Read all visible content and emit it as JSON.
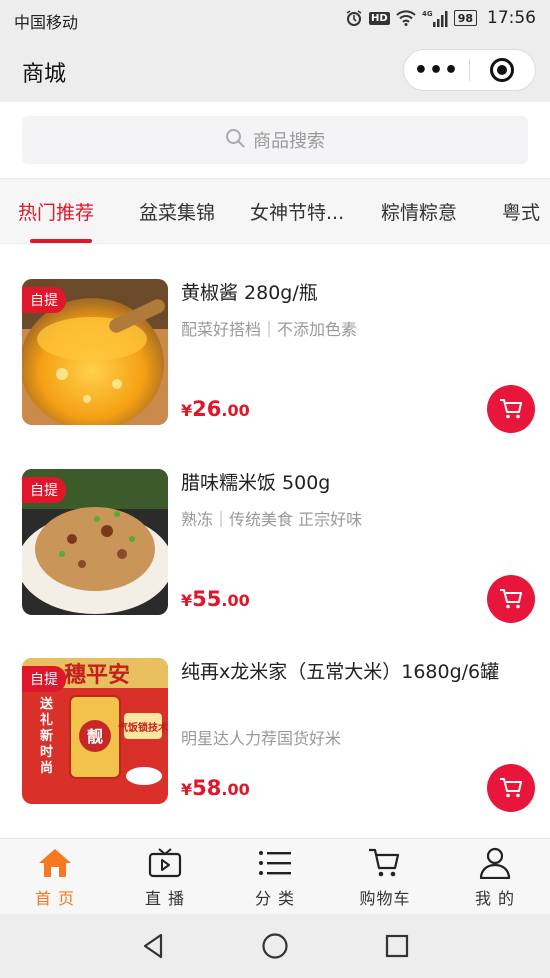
{
  "status_bar": {
    "carrier": "中国移动",
    "hd": "HD",
    "network": "4G",
    "battery": "98",
    "time": "17:56"
  },
  "nav": {
    "title": "商城",
    "more": "•••"
  },
  "search": {
    "placeholder": "商品搜索"
  },
  "tabs": [
    "热门推荐",
    "盆菜集锦",
    "女神节特...",
    "粽情粽意",
    "粤式"
  ],
  "products": [
    {
      "badge": "自提",
      "title": "黄椒酱 280g/瓶",
      "subtitle": "配菜好搭档｜不添加色素",
      "currency": "¥",
      "price_int": "26",
      "price_dec": ".00"
    },
    {
      "badge": "自提",
      "title": "腊味糯米饭 500g",
      "subtitle": "熟冻｜传统美食 正宗好味",
      "currency": "¥",
      "price_int": "55",
      "price_dec": ".00"
    },
    {
      "badge": "自提",
      "title": "纯再x龙米家（五常大米）1680g/6罐",
      "subtitle": "明星达人力荐国货好米",
      "currency": "¥",
      "price_int": "58",
      "price_dec": ".00",
      "image_text": {
        "top": "穗平安",
        "side": "送礼新时尚",
        "seal": "靓",
        "slogan": "气饭锁技术"
      }
    }
  ],
  "bottom_nav": [
    {
      "label": "首 页",
      "icon": "home-icon"
    },
    {
      "label": "直 播",
      "icon": "tv-icon"
    },
    {
      "label": "分 类",
      "icon": "list-icon"
    },
    {
      "label": "购物车",
      "icon": "cart-icon"
    },
    {
      "label": "我 的",
      "icon": "user-icon"
    }
  ],
  "colors": {
    "accent": "#e0162b",
    "home_active": "#f57a1f"
  }
}
